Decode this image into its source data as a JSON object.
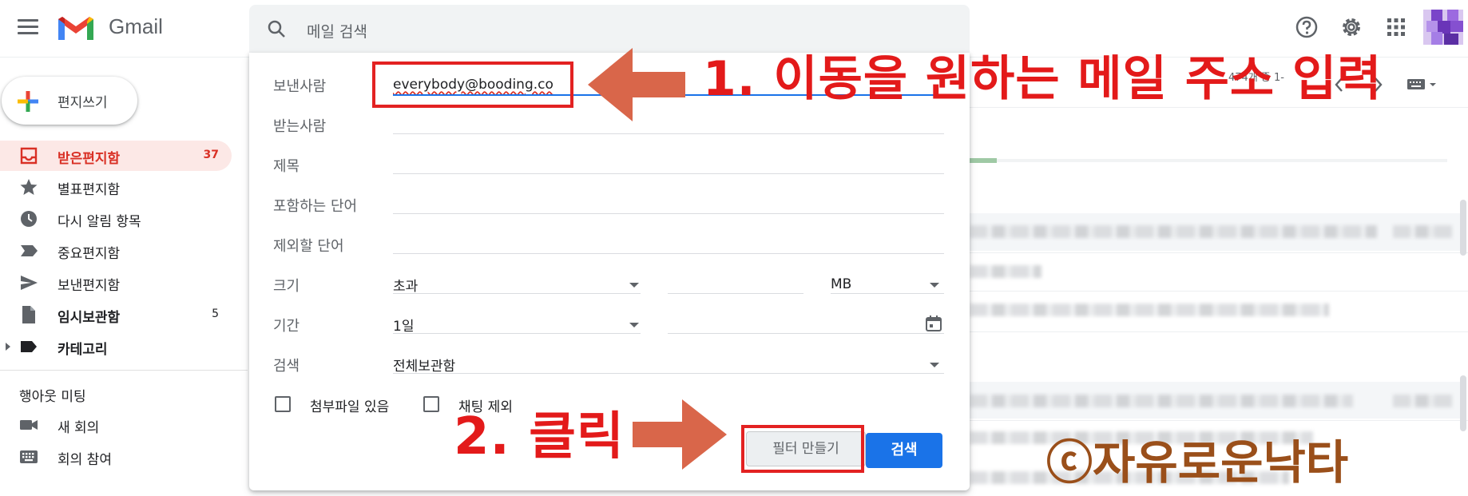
{
  "app": {
    "name": "Gmail"
  },
  "search": {
    "placeholder": "메일 검색"
  },
  "sidebar": {
    "compose_label": "편지쓰기",
    "items": [
      {
        "label": "받은편지함",
        "count": "37"
      },
      {
        "label": "별표편지함",
        "count": ""
      },
      {
        "label": "다시 알림 항목",
        "count": ""
      },
      {
        "label": "중요편지함",
        "count": ""
      },
      {
        "label": "보낸편지함",
        "count": ""
      },
      {
        "label": "임시보관함",
        "count": "5"
      },
      {
        "label": "카테고리",
        "count": ""
      }
    ],
    "meet_header": "행아웃 미팅",
    "meet_items": [
      {
        "label": "새 회의"
      },
      {
        "label": "회의 참여"
      }
    ]
  },
  "toolbar": {
    "page_info": "474개 중 1-"
  },
  "filter_panel": {
    "from_label": "보낸사람",
    "from_value": "everybody@booding.co",
    "to_label": "받는사람",
    "subject_label": "제목",
    "has_words_label": "포함하는 단어",
    "doesnt_have_label": "제외할 단어",
    "size_label": "크기",
    "size_op": "초과",
    "size_unit": "MB",
    "date_label": "기간",
    "date_range": "1일",
    "search_in_label": "검색",
    "search_in_value": "전체보관함",
    "has_attachment_label": "첨부파일 있음",
    "exclude_chats_label": "채팅 제외",
    "create_filter_label": "필터 만들기",
    "search_button_label": "검색"
  },
  "annotations": {
    "step1": "1. 이동을 원하는 메일 주소 입력",
    "step2": "2. 클릭",
    "watermark": "ⓒ자유로운낙타",
    "box_color": "#e32222",
    "arrow_color": "#d9664a"
  }
}
